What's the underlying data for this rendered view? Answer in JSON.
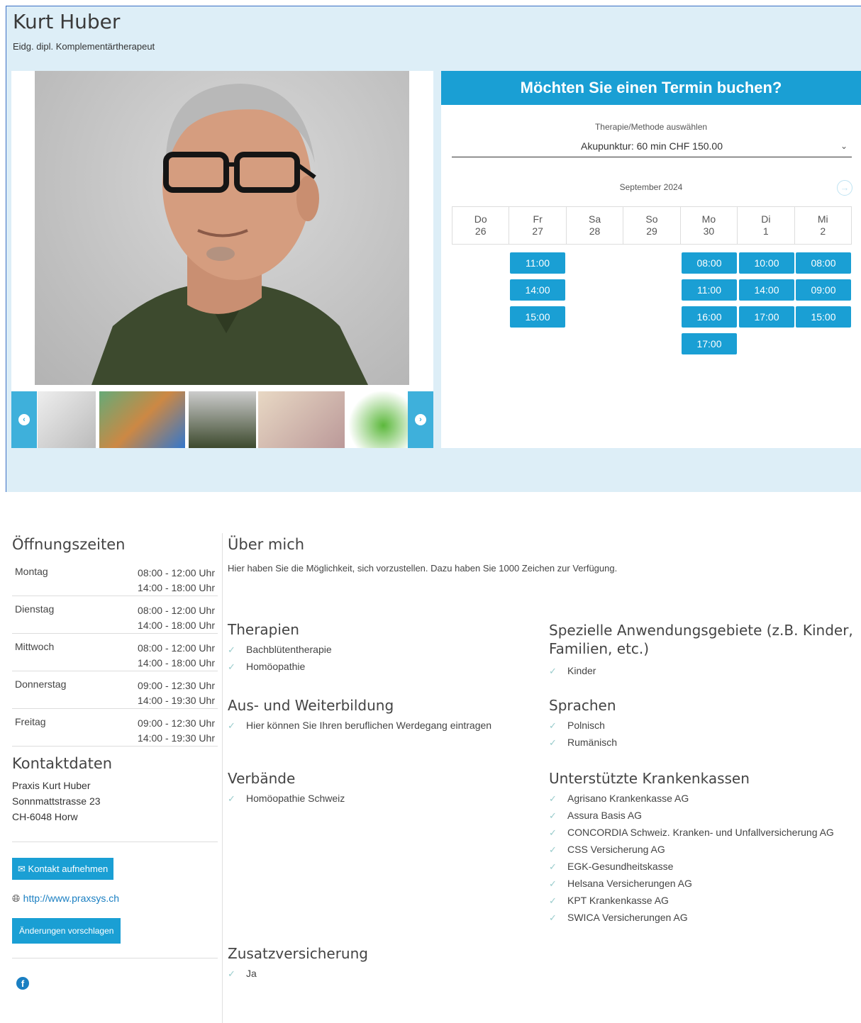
{
  "header": {
    "name": "Kurt Huber",
    "subtitle": "Eidg. dipl. Komplementärtherapeut"
  },
  "booking": {
    "title": "Möchten Sie einen Termin buchen?",
    "therapy_label": "Therapie/Methode auswählen",
    "therapy_value": "Akupunktur: 60 min CHF 150.00",
    "month": "September 2024",
    "days": [
      {
        "name": "Do",
        "date": "26"
      },
      {
        "name": "Fr",
        "date": "27"
      },
      {
        "name": "Sa",
        "date": "28"
      },
      {
        "name": "So",
        "date": "29"
      },
      {
        "name": "Mo",
        "date": "30"
      },
      {
        "name": "Di",
        "date": "1"
      },
      {
        "name": "Mi",
        "date": "2"
      }
    ],
    "slots": {
      "fr": [
        "11:00",
        "14:00",
        "15:00"
      ],
      "mo": [
        "08:00",
        "11:00",
        "16:00",
        "17:00"
      ],
      "di": [
        "10:00",
        "14:00",
        "17:00"
      ],
      "mi": [
        "08:00",
        "09:00",
        "15:00"
      ]
    }
  },
  "hours": {
    "title": "Öffnungszeiten",
    "rows": [
      {
        "day": "Montag",
        "t1": "08:00 - 12:00 Uhr",
        "t2": "14:00 - 18:00 Uhr"
      },
      {
        "day": "Dienstag",
        "t1": "08:00 - 12:00 Uhr",
        "t2": "14:00 - 18:00 Uhr"
      },
      {
        "day": "Mittwoch",
        "t1": "08:00 - 12:00 Uhr",
        "t2": "14:00 - 18:00 Uhr"
      },
      {
        "day": "Donnerstag",
        "t1": "09:00 - 12:30 Uhr",
        "t2": "14:00 - 19:30 Uhr"
      },
      {
        "day": "Freitag",
        "t1": "09:00 - 12:30 Uhr",
        "t2": "14:00 - 19:30 Uhr"
      }
    ]
  },
  "contact": {
    "title": "Kontaktdaten",
    "line1": "Praxis Kurt Huber",
    "line2": "Sonnmattstrasse 23",
    "line3": "CH-6048 Horw",
    "contact_button": "Kontakt aufnehmen",
    "website": "http://www.praxsys.ch",
    "suggest_button": "Änderungen vorschlagen"
  },
  "about": {
    "title": "Über mich",
    "text": "Hier haben Sie die Möglichkeit, sich vorzustellen. Dazu haben Sie 1000 Zeichen zur Verfügung."
  },
  "therapien": {
    "title": "Therapien",
    "items": [
      "Bachblütentherapie",
      "Homöopathie"
    ]
  },
  "ausbildung": {
    "title": "Aus- und Weiterbildung",
    "items": [
      "Hier können Sie Ihren beruflichen Werdegang eintragen"
    ]
  },
  "verbaende": {
    "title": "Verbände",
    "items": [
      "Homöopathie Schweiz"
    ]
  },
  "zusatz": {
    "title": "Zusatzversicherung",
    "items": [
      "Ja"
    ]
  },
  "anwendung": {
    "title": "Spezielle Anwendungsgebiete (z.B. Kinder, Familien, etc.)",
    "items": [
      "Kinder"
    ]
  },
  "sprachen": {
    "title": "Sprachen",
    "items": [
      "Polnisch",
      "Rumänisch"
    ]
  },
  "kassen": {
    "title": "Unterstützte Krankenkassen",
    "items": [
      "Agrisano Krankenkasse AG",
      "Assura Basis AG",
      "CONCORDIA Schweiz. Kranken- und Unfallversicherung AG",
      "CSS Versicherung AG",
      "EGK-Gesundheitskasse",
      "Helsana Versicherungen AG",
      "KPT Krankenkasse AG",
      "SWICA Versicherungen AG"
    ]
  },
  "colors": {
    "accent": "#1a9fd4",
    "band": "#ddeef7"
  },
  "icons": [
    "chevron-left-icon",
    "chevron-right-icon",
    "chevron-down-icon",
    "mail-icon",
    "globe-icon",
    "check-icon",
    "facebook-icon"
  ]
}
